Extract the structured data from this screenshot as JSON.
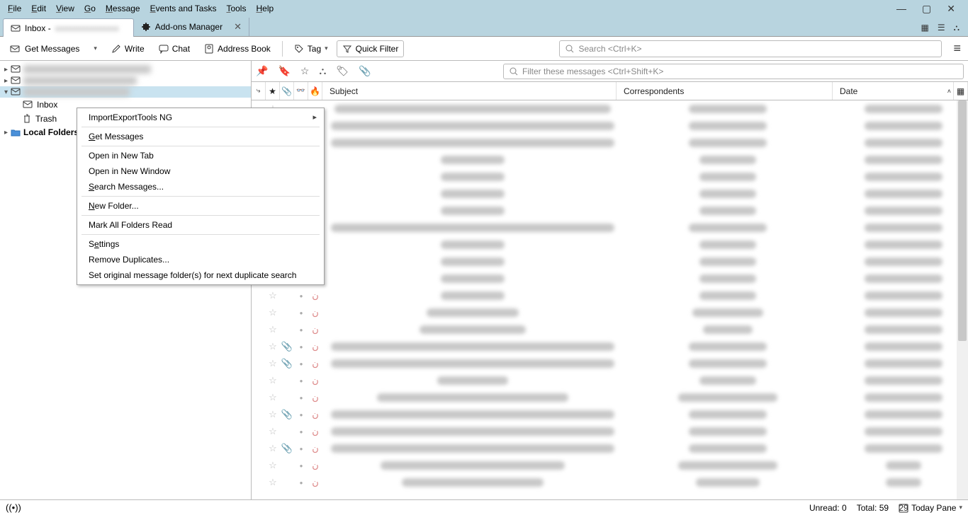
{
  "menus": [
    "File",
    "Edit",
    "View",
    "Go",
    "Message",
    "Events and Tasks",
    "Tools",
    "Help"
  ],
  "tabs": {
    "inbox_prefix": "Inbox - ",
    "addons": "Add-ons Manager"
  },
  "toolbar": {
    "get": "Get Messages",
    "write": "Write",
    "chat": "Chat",
    "ab": "Address Book",
    "tag": "Tag",
    "qf": "Quick Filter"
  },
  "search": {
    "global": "Search <Ctrl+K>",
    "filter": "Filter these messages <Ctrl+Shift+K>"
  },
  "folders": {
    "inbox": "Inbox",
    "trash": "Trash",
    "local": "Local Folders"
  },
  "ctx": {
    "iet": "ImportExportTools NG",
    "get": "Get Messages",
    "opent": "Open in New Tab",
    "openw": "Open in New Window",
    "search": "Search Messages...",
    "newf": "New Folder...",
    "markall": "Mark All Folders Read",
    "settings": "Settings",
    "remdup": "Remove Duplicates...",
    "setorig": "Set original message folder(s) for next duplicate search"
  },
  "cols": {
    "subject": "Subject",
    "corr": "Correspondents",
    "date": "Date"
  },
  "rows": [
    {
      "att": false,
      "sw": 390,
      "cw": 110,
      "dw": 110
    },
    {
      "att": false,
      "sw": 400,
      "cw": 110,
      "dw": 110
    },
    {
      "att": false,
      "sw": 400,
      "cw": 110,
      "dw": 110
    },
    {
      "att": false,
      "sw": 90,
      "cw": 80,
      "dw": 110
    },
    {
      "att": false,
      "sw": 90,
      "cw": 80,
      "dw": 110
    },
    {
      "att": false,
      "sw": 90,
      "cw": 80,
      "dw": 110
    },
    {
      "att": false,
      "sw": 90,
      "cw": 80,
      "dw": 110
    },
    {
      "att": false,
      "sw": 400,
      "cw": 110,
      "dw": 110
    },
    {
      "att": false,
      "sw": 90,
      "cw": 80,
      "dw": 110
    },
    {
      "att": false,
      "sw": 90,
      "cw": 80,
      "dw": 110
    },
    {
      "att": false,
      "sw": 90,
      "cw": 80,
      "dw": 110
    },
    {
      "att": false,
      "sw": 90,
      "cw": 80,
      "dw": 110
    },
    {
      "att": false,
      "sw": 130,
      "cw": 100,
      "dw": 110
    },
    {
      "att": false,
      "sw": 150,
      "cw": 70,
      "dw": 110
    },
    {
      "att": true,
      "sw": 400,
      "cw": 110,
      "dw": 110
    },
    {
      "att": true,
      "sw": 400,
      "cw": 110,
      "dw": 110
    },
    {
      "att": false,
      "sw": 100,
      "cw": 80,
      "dw": 110
    },
    {
      "att": false,
      "sw": 270,
      "cw": 140,
      "dw": 110
    },
    {
      "att": true,
      "sw": 400,
      "cw": 110,
      "dw": 110
    },
    {
      "att": false,
      "sw": 400,
      "cw": 110,
      "dw": 110
    },
    {
      "att": true,
      "sw": 400,
      "cw": 110,
      "dw": 110
    },
    {
      "att": false,
      "sw": 260,
      "cw": 140,
      "dw": 50
    },
    {
      "att": false,
      "sw": 200,
      "cw": 90,
      "dw": 50
    }
  ],
  "status": {
    "unread_l": "Unread:",
    "unread_v": "0",
    "total_l": "Total:",
    "total_v": "59",
    "today": "Today Pane"
  }
}
